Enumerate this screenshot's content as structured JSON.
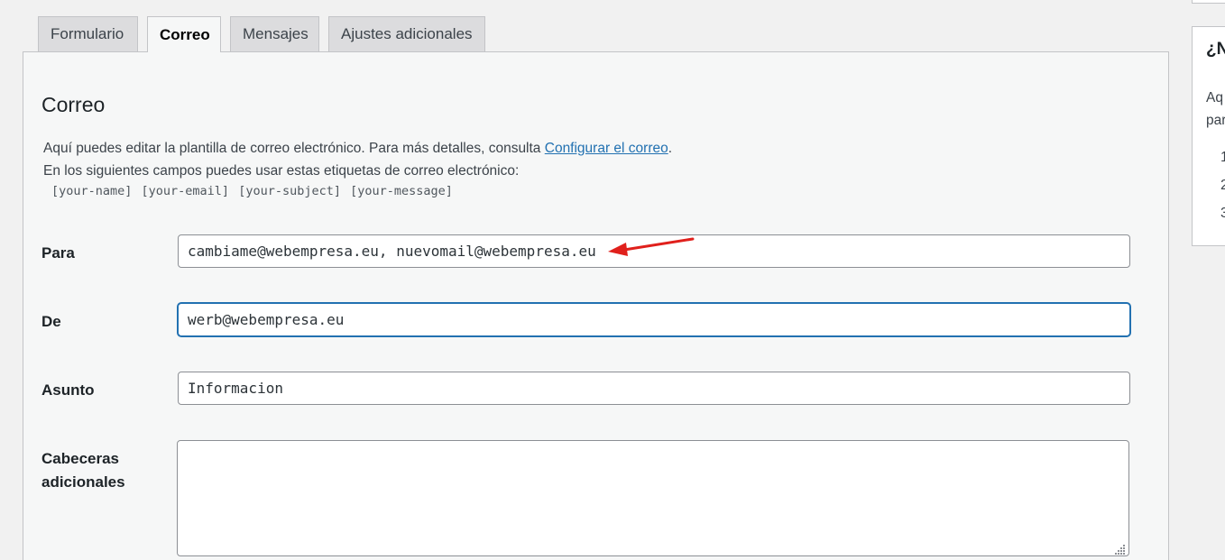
{
  "tabs": [
    {
      "label": "Formulario",
      "active": false
    },
    {
      "label": "Correo",
      "active": true
    },
    {
      "label": "Mensajes",
      "active": false
    },
    {
      "label": "Ajustes adicionales",
      "active": false
    }
  ],
  "mail": {
    "title": "Correo",
    "desc_before_link": "Aquí puedes editar la plantilla de correo electrónico. Para más detalles, consulta ",
    "desc_link": "Configurar el correo",
    "desc_after_link": ".",
    "desc_line2": "En los siguientes campos puedes usar estas etiquetas de correo electrónico:",
    "tags": "[your-name] [your-email] [your-subject] [your-message]"
  },
  "fields": {
    "para": {
      "label": "Para",
      "value": "cambiame@webempresa.eu, nuevomail@webempresa.eu"
    },
    "de": {
      "label": "De",
      "value": "werb@webempresa.eu"
    },
    "asunto": {
      "label": "Asunto",
      "value": "Informacion"
    },
    "cabeceras": {
      "label_line1": "Cabeceras",
      "label_line2": "adicionales",
      "value": ""
    }
  },
  "sidebar": {
    "title": "¿N",
    "text_line1": "Aq",
    "text_line2": "par",
    "list": [
      "1",
      "2",
      "3"
    ]
  },
  "annotation": {
    "arrow_color": "#e0201c"
  },
  "colors": {
    "accent": "#2271b1",
    "panel_bg": "#f6f7f7",
    "page_bg": "#f1f1f1"
  }
}
